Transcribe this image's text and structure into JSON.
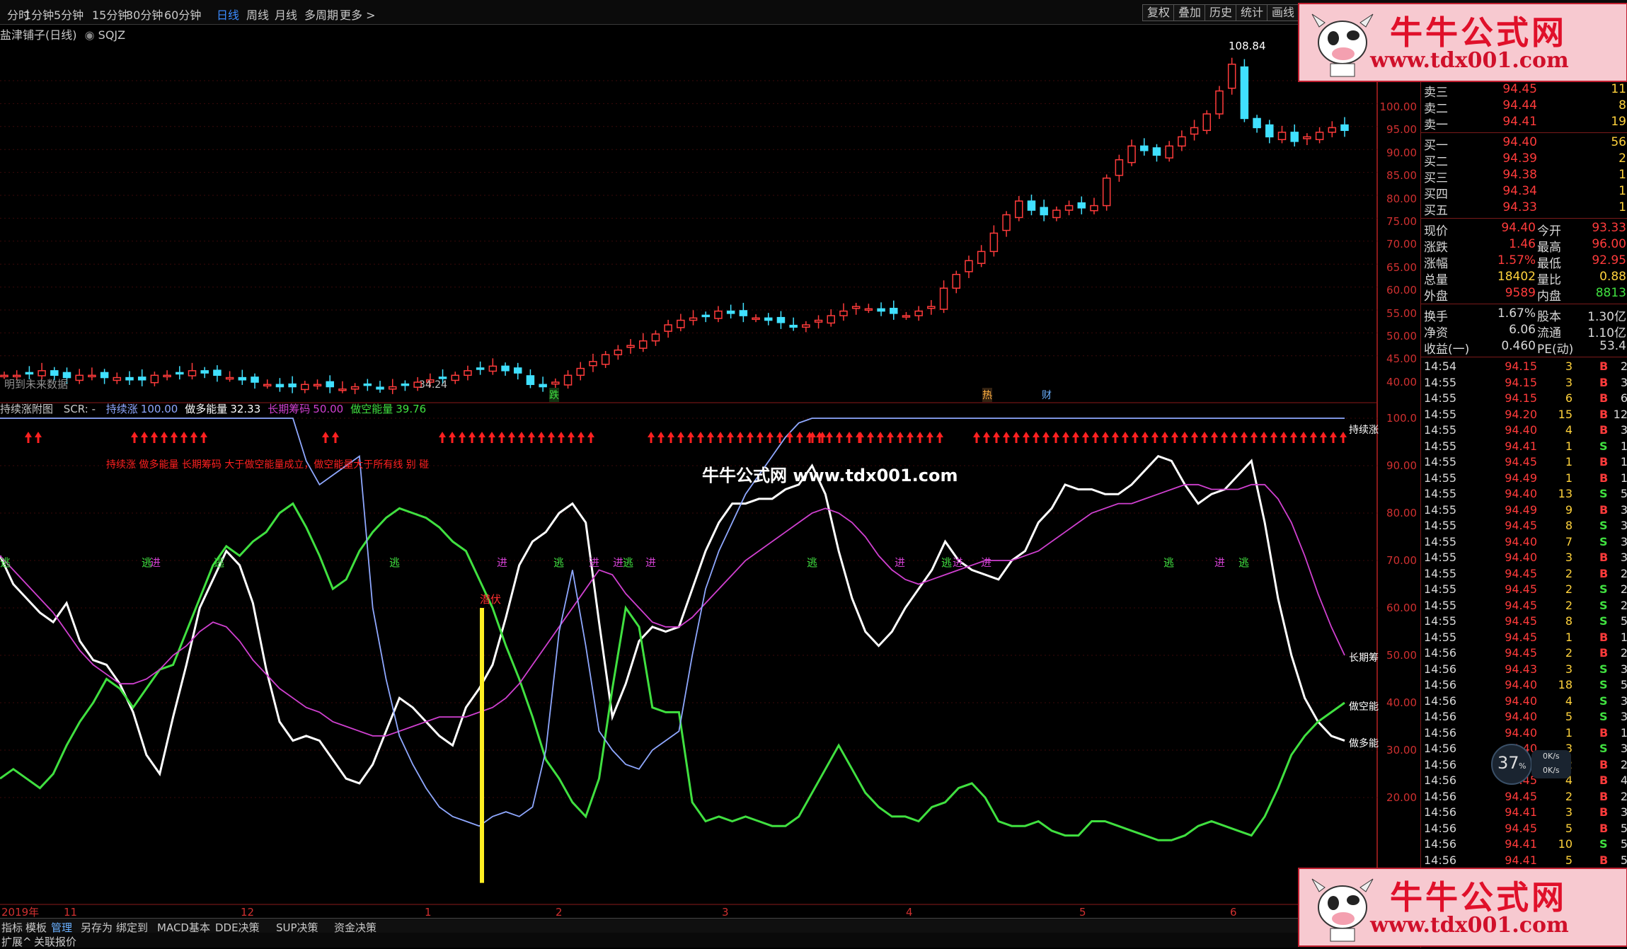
{
  "toolbar": {
    "periods": [
      "分时",
      "1分钟",
      "5分钟",
      "15分钟",
      "30分钟",
      "60分钟",
      "日线",
      "周线",
      "月线",
      "多周期",
      "更多 >"
    ],
    "active_period": "日线",
    "right_buttons": [
      "复权",
      "叠加",
      "历史",
      "统计",
      "画线"
    ]
  },
  "chart_title": "盐津铺子(日线)",
  "formula_name": "SQJZ",
  "main_chart": {
    "y_ticks": [
      "100.00",
      "95.00",
      "90.00",
      "85.00",
      "80.00",
      "75.00",
      "70.00",
      "65.00",
      "60.00",
      "55.00",
      "50.00",
      "45.00",
      "40.00"
    ],
    "high_label": "108.84",
    "low_label": "34.24",
    "future_note": "明到未来数据",
    "marker_labels": [
      "跌",
      "热",
      "财"
    ]
  },
  "indicator": {
    "name": "持续涨附图",
    "scr": "SCR: -",
    "series": [
      {
        "name": "持续涨",
        "value": "100.00",
        "color": "#8fa8ff"
      },
      {
        "name": "做多能量",
        "value": "32.33",
        "color": "#ffffff"
      },
      {
        "name": "长期筹码",
        "value": "50.00",
        "color": "#d040d0"
      },
      {
        "name": "做空能量",
        "value": "39.76",
        "color": "#40e040"
      }
    ],
    "note": "持续涨 做多能量 长期筹码 大于做空能量成立，做空能量大于所有线 别 碰",
    "y_ticks": [
      "100.0",
      "90.00",
      "80.00",
      "70.00",
      "60.00",
      "50.00",
      "40.00",
      "30.00",
      "20.00"
    ],
    "right_labels": [
      "持续涨",
      "长期筹",
      "做空能",
      "做多能"
    ],
    "signal_in": "进",
    "signal_out": "逃",
    "signal_lurk": "潜伏",
    "watermark": "牛牛公式网 www.tdx001.com"
  },
  "chart_data": {
    "type": "line",
    "title": "持续涨附图",
    "ylim": [
      10,
      100
    ],
    "x_axis_labels": [
      "2019年",
      "11",
      "12",
      "1",
      "2",
      "3",
      "4",
      "5",
      "6"
    ],
    "series": [
      {
        "name": "做多能量",
        "values": [
          71,
          65,
          62,
          59,
          57,
          61,
          53,
          49,
          48,
          44,
          38,
          29,
          25,
          37,
          48,
          60,
          66,
          72,
          69,
          61,
          47,
          36,
          32,
          33,
          32,
          28,
          24,
          23,
          27,
          34,
          41,
          39,
          36,
          33,
          31,
          39,
          43,
          48,
          58,
          69,
          74,
          76,
          80,
          82,
          78,
          57,
          37,
          44,
          53,
          56,
          55,
          56,
          64,
          72,
          78,
          82,
          82,
          83,
          83,
          85,
          86,
          90,
          84,
          72,
          62,
          55,
          52,
          55,
          60,
          64,
          68,
          74,
          70,
          68,
          67,
          66,
          70,
          72,
          78,
          81,
          86,
          85,
          85,
          84,
          84,
          86,
          89,
          92,
          91,
          86,
          82,
          84,
          85,
          88,
          91,
          78,
          62,
          50,
          41,
          36,
          33,
          32
        ]
      },
      {
        "name": "做空能量",
        "values": [
          24,
          26,
          24,
          22,
          25,
          31,
          36,
          40,
          45,
          43,
          39,
          43,
          47,
          48,
          55,
          62,
          69,
          73,
          71,
          74,
          76,
          80,
          82,
          77,
          71,
          64,
          66,
          72,
          76,
          79,
          81,
          80,
          79,
          77,
          74,
          72,
          66,
          60,
          52,
          45,
          37,
          28,
          24,
          19,
          16,
          24,
          43,
          60,
          56,
          39,
          38,
          38,
          19,
          15,
          16,
          15,
          16,
          15,
          14,
          14,
          16,
          21,
          26,
          31,
          26,
          21,
          18,
          16,
          16,
          15,
          18,
          19,
          22,
          23,
          20,
          15,
          14,
          14,
          15,
          13,
          12,
          12,
          15,
          15,
          14,
          13,
          12,
          11,
          11,
          12,
          14,
          15,
          14,
          13,
          12,
          16,
          22,
          29,
          33,
          36,
          38,
          40
        ]
      },
      {
        "name": "长期筹码",
        "values": [
          71,
          68,
          65,
          62,
          59,
          55,
          51,
          48,
          46,
          44,
          44,
          45,
          47,
          50,
          52,
          55,
          57,
          56,
          53,
          49,
          46,
          43,
          41,
          39,
          38,
          36,
          35,
          34,
          33,
          33,
          34,
          35,
          36,
          37,
          37,
          37,
          38,
          39,
          41,
          44,
          48,
          52,
          56,
          60,
          64,
          68,
          67,
          63,
          60,
          57,
          56,
          56,
          58,
          61,
          64,
          67,
          70,
          72,
          74,
          76,
          78,
          80,
          81,
          80,
          78,
          75,
          71,
          68,
          66,
          65,
          66,
          67,
          68,
          69,
          70,
          70,
          70,
          71,
          72,
          74,
          76,
          78,
          80,
          81,
          82,
          82,
          83,
          84,
          85,
          86,
          86,
          85,
          85,
          85,
          86,
          86,
          83,
          78,
          71,
          63,
          56,
          50
        ]
      },
      {
        "name": "持续涨",
        "values": [
          100,
          100,
          100,
          100,
          100,
          100,
          100,
          100,
          100,
          100,
          100,
          100,
          100,
          100,
          100,
          100,
          100,
          100,
          100,
          100,
          100,
          100,
          100,
          91,
          86,
          88,
          90,
          92,
          60,
          45,
          33,
          27,
          22,
          18,
          16,
          15,
          14,
          16,
          17,
          16,
          18,
          30,
          55,
          68,
          52,
          34,
          30,
          27,
          26,
          30,
          32,
          34,
          50,
          64,
          72,
          78,
          84,
          88,
          92,
          96,
          99,
          100,
          100,
          100,
          100,
          100,
          100,
          100,
          100,
          100,
          100,
          100,
          100,
          100,
          100,
          100,
          100,
          100,
          100,
          100,
          100,
          100,
          100,
          100,
          100,
          100,
          100,
          100,
          100,
          100,
          100,
          100,
          100,
          100,
          100,
          100,
          100,
          100,
          100,
          100,
          100,
          100
        ]
      }
    ]
  },
  "bottom_tabs": [
    "指标",
    "模板",
    "管理",
    "另存为",
    "绑定到",
    "MACD基本",
    "DDE决策",
    "SUP决策",
    "资金决策"
  ],
  "active_bottom_tab": "管理",
  "bottom2": [
    "扩展^",
    "关联报价"
  ],
  "logo": {
    "title": "牛牛公式网",
    "url": "www.tdx001.com"
  },
  "quote": {
    "asks": [
      {
        "label": "卖三",
        "price": "94.45",
        "vol": "11"
      },
      {
        "label": "卖二",
        "price": "94.44",
        "vol": "8"
      },
      {
        "label": "卖一",
        "price": "94.41",
        "vol": "19"
      }
    ],
    "bids": [
      {
        "label": "买一",
        "price": "94.40",
        "vol": "56"
      },
      {
        "label": "买二",
        "price": "94.39",
        "vol": "2"
      },
      {
        "label": "买三",
        "price": "94.38",
        "vol": "1"
      },
      {
        "label": "买四",
        "price": "94.34",
        "vol": "1"
      },
      {
        "label": "买五",
        "price": "94.33",
        "vol": "1"
      }
    ],
    "fields": [
      {
        "l1": "现价",
        "v1": "94.40",
        "c1": "#ff3b3b",
        "l2": "今开",
        "v2": "93.33",
        "c2": "#ff3b3b"
      },
      {
        "l1": "涨跌",
        "v1": "1.46",
        "c1": "#ff3b3b",
        "l2": "最高",
        "v2": "96.00",
        "c2": "#ff3b3b"
      },
      {
        "l1": "涨幅",
        "v1": "1.57%",
        "c1": "#ff3b3b",
        "l2": "最低",
        "v2": "92.95",
        "c2": "#ff3b3b"
      },
      {
        "l1": "总量",
        "v1": "18402",
        "c1": "#ffd23c",
        "l2": "量比",
        "v2": "0.88",
        "c2": "#ffd23c"
      },
      {
        "l1": "外盘",
        "v1": "9589",
        "c1": "#ff3b3b",
        "l2": "内盘",
        "v2": "8813",
        "c2": "#40e040"
      },
      {
        "l1": "换手",
        "v1": "1.67%",
        "c1": "#d8d8d8",
        "l2": "股本",
        "v2": "1.30亿",
        "c2": "#d8d8d8"
      },
      {
        "l1": "净资",
        "v1": "6.06",
        "c1": "#d8d8d8",
        "l2": "流通",
        "v2": "1.10亿",
        "c2": "#d8d8d8"
      },
      {
        "l1": "收益(一)",
        "v1": "0.460",
        "c1": "#d8d8d8",
        "l2": "PE(动)",
        "v2": "53.4",
        "c2": "#d8d8d8"
      }
    ],
    "ticks": [
      {
        "t": "14:54",
        "p": "94.15",
        "v": "3",
        "bs": "B",
        "x": "2"
      },
      {
        "t": "14:55",
        "p": "94.15",
        "v": "3",
        "bs": "B",
        "x": "3"
      },
      {
        "t": "14:55",
        "p": "94.15",
        "v": "6",
        "bs": "B",
        "x": "6"
      },
      {
        "t": "14:55",
        "p": "94.20",
        "v": "15",
        "bs": "B",
        "x": "12"
      },
      {
        "t": "14:55",
        "p": "94.40",
        "v": "4",
        "bs": "B",
        "x": "3"
      },
      {
        "t": "14:55",
        "p": "94.41",
        "v": "1",
        "bs": "S",
        "x": "1"
      },
      {
        "t": "14:55",
        "p": "94.45",
        "v": "1",
        "bs": "B",
        "x": "1"
      },
      {
        "t": "14:55",
        "p": "94.49",
        "v": "1",
        "bs": "B",
        "x": "1"
      },
      {
        "t": "14:55",
        "p": "94.40",
        "v": "13",
        "bs": "S",
        "x": "5"
      },
      {
        "t": "14:55",
        "p": "94.49",
        "v": "9",
        "bs": "B",
        "x": "3"
      },
      {
        "t": "14:55",
        "p": "94.45",
        "v": "8",
        "bs": "S",
        "x": "3"
      },
      {
        "t": "14:55",
        "p": "94.40",
        "v": "7",
        "bs": "S",
        "x": "3"
      },
      {
        "t": "14:55",
        "p": "94.40",
        "v": "3",
        "bs": "B",
        "x": "3"
      },
      {
        "t": "14:55",
        "p": "94.45",
        "v": "2",
        "bs": "B",
        "x": "2"
      },
      {
        "t": "14:55",
        "p": "94.45",
        "v": "2",
        "bs": "S",
        "x": "2"
      },
      {
        "t": "14:55",
        "p": "94.45",
        "v": "2",
        "bs": "S",
        "x": "2"
      },
      {
        "t": "14:55",
        "p": "94.45",
        "v": "8",
        "bs": "S",
        "x": "5"
      },
      {
        "t": "14:55",
        "p": "94.45",
        "v": "1",
        "bs": "B",
        "x": "1"
      },
      {
        "t": "14:56",
        "p": "94.45",
        "v": "2",
        "bs": "B",
        "x": "2"
      },
      {
        "t": "14:56",
        "p": "94.43",
        "v": "3",
        "bs": "S",
        "x": "3"
      },
      {
        "t": "14:56",
        "p": "94.40",
        "v": "18",
        "bs": "S",
        "x": "5"
      },
      {
        "t": "14:56",
        "p": "94.40",
        "v": "4",
        "bs": "S",
        "x": "3"
      },
      {
        "t": "14:56",
        "p": "94.40",
        "v": "5",
        "bs": "S",
        "x": "3"
      },
      {
        "t": "14:56",
        "p": "94.40",
        "v": "1",
        "bs": "B",
        "x": "1"
      },
      {
        "t": "14:56",
        "p": "94.40",
        "v": "3",
        "bs": "S",
        "x": "3"
      },
      {
        "t": "14:56",
        "p": "94.45",
        "v": "2",
        "bs": "B",
        "x": "2"
      },
      {
        "t": "14:56",
        "p": "94.45",
        "v": "4",
        "bs": "B",
        "x": "4"
      },
      {
        "t": "14:56",
        "p": "94.45",
        "v": "2",
        "bs": "B",
        "x": "2"
      },
      {
        "t": "14:56",
        "p": "94.41",
        "v": "3",
        "bs": "B",
        "x": "3"
      },
      {
        "t": "14:56",
        "p": "94.45",
        "v": "5",
        "bs": "B",
        "x": "5"
      },
      {
        "t": "14:56",
        "p": "94.41",
        "v": "10",
        "bs": "S",
        "x": "5"
      },
      {
        "t": "14:56",
        "p": "94.41",
        "v": "5",
        "bs": "B",
        "x": "5"
      }
    ]
  },
  "gauge": {
    "percent": "37",
    "unit": "%",
    "up": "0K/s",
    "down": "0K/s"
  }
}
